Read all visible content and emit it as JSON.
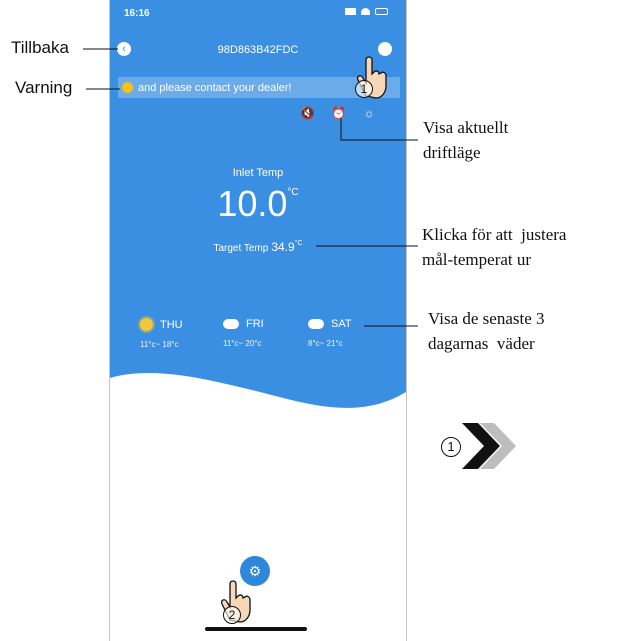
{
  "status_bar": {
    "time": "16:16"
  },
  "header": {
    "device_id": "98D863B42FDC"
  },
  "warning": {
    "text": "and please contact your dealer!"
  },
  "inlet": {
    "label": "Inlet Temp",
    "value": "10.0",
    "unit": "°C"
  },
  "target": {
    "label": "Target Temp",
    "value": "34.9",
    "unit": "°C"
  },
  "forecast": [
    {
      "day": "THU",
      "range": "11°c~ 18°c",
      "icon": "sun-icon"
    },
    {
      "day": "FRI",
      "range": "11°c~ 20°c",
      "icon": "partly-cloudy-icon"
    },
    {
      "day": "SAT",
      "range": "8°c~ 21°c",
      "icon": "partly-cloudy-icon"
    }
  ],
  "annotations": {
    "back": "Tillbaka",
    "warning": "Varning",
    "mode_1": "Visa aktuellt",
    "mode_2": "driftläge",
    "target_1": "Klicka för att  justera",
    "target_2": "mål-temperat ur",
    "weather_1": "Visa de senaste 3",
    "weather_2": "dagarnas  väder",
    "step1": "①",
    "step2": "②",
    "step1_side": "①"
  },
  "colors": {
    "blue": "#3a8fe3",
    "accent": "#2f87db",
    "warning_dot": "#f4c316"
  }
}
